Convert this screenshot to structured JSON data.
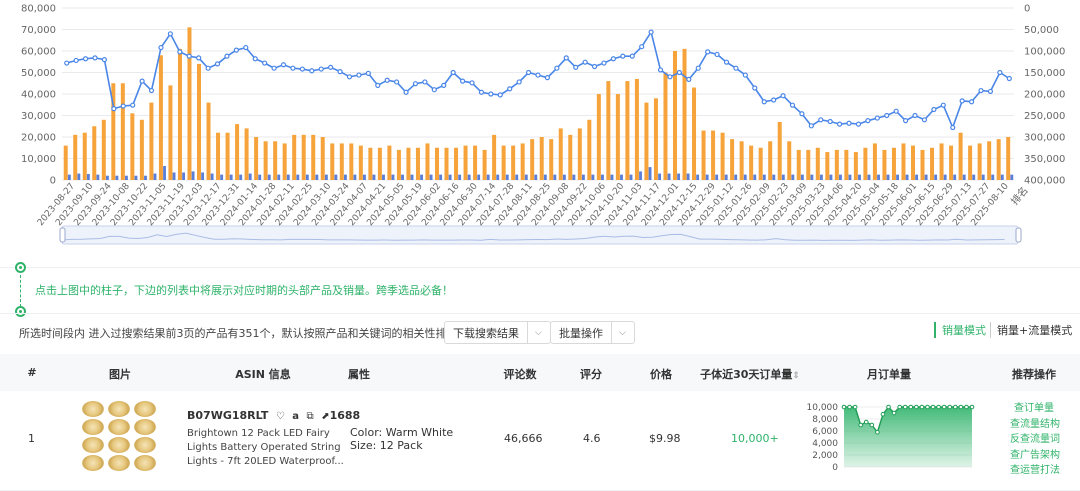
{
  "chart_data": {
    "type": "bar+line",
    "y_left_ticks": [
      "0",
      "10,000",
      "20,000",
      "30,000",
      "40,000",
      "50,000",
      "60,000",
      "70,000",
      "80,000"
    ],
    "y_left_range": [
      0,
      80000
    ],
    "y_right_ticks": [
      "0",
      "50,000",
      "100,000",
      "150,000",
      "200,000",
      "250,000",
      "300,000",
      "350,000",
      "400,000"
    ],
    "y_right_range": [
      0,
      400000
    ],
    "y_right_inverted": true,
    "right_axis_label": "排名",
    "x_labels": [
      "2023-08-27",
      "2023-09-10",
      "2023-09-24",
      "2023-10-08",
      "2023-10-22",
      "2023-11-05",
      "2023-11-19",
      "2023-12-03",
      "2023-12-17",
      "2023-12-31",
      "2024-01-14",
      "2024-01-28",
      "2024-02-11",
      "2024-02-25",
      "2024-03-10",
      "2024-03-24",
      "2024-04-07",
      "2024-04-21",
      "2024-05-05",
      "2024-05-19",
      "2024-06-02",
      "2024-06-16",
      "2024-06-30",
      "2024-07-14",
      "2024-07-28",
      "2024-08-11",
      "2024-08-25",
      "2024-09-08",
      "2024-09-22",
      "2024-10-06",
      "2024-10-20",
      "2024-11-03",
      "2024-11-17",
      "2024-12-01",
      "2024-12-15",
      "2024-12-29",
      "2025-01-12",
      "2025-01-26",
      "2025-02-09",
      "2025-02-23",
      "2025-03-09",
      "2025-03-23",
      "2025-04-06",
      "2025-04-20",
      "2025-05-04",
      "2025-05-18",
      "2025-06-01",
      "2025-06-15",
      "2025-06-29",
      "2025-07-13",
      "2025-07-27",
      "2025-08-10"
    ],
    "series": [
      {
        "name": "orange-bars",
        "color": "#f5a33a",
        "values": [
          16000,
          21000,
          22000,
          25000,
          28000,
          45000,
          45000,
          31000,
          28000,
          36000,
          58000,
          44000,
          61000,
          71000,
          54000,
          36000,
          22000,
          22000,
          26000,
          24000,
          20000,
          18000,
          18000,
          17000,
          21000,
          21000,
          21000,
          20000,
          17000,
          17000,
          17000,
          16000,
          15000,
          15000,
          16000,
          14000,
          15000,
          15000,
          17000,
          15000,
          15000,
          15000,
          16000,
          16000,
          14000,
          21000,
          16000,
          16000,
          17000,
          19000,
          20000,
          19000,
          24000,
          21000,
          24000,
          28000,
          40000,
          46000,
          40000,
          46000,
          47000,
          36000,
          38000,
          50000,
          60000,
          61000,
          43000,
          23000,
          23000,
          22000,
          19000,
          18000,
          16000,
          15000,
          18000,
          27000,
          18000,
          14000,
          14000,
          15000,
          13000,
          14000,
          14000,
          13000,
          15000,
          17000,
          14000,
          15000,
          17000,
          16000,
          14000,
          15000,
          17000,
          16000,
          22000,
          16000,
          17000,
          18000,
          19000,
          20000
        ]
      },
      {
        "name": "blue-bars",
        "color": "#5b7fd6",
        "values": [
          2500,
          3000,
          2800,
          2500,
          2000,
          2000,
          2000,
          2000,
          2000,
          3000,
          6500,
          3500,
          3500,
          4000,
          3500,
          3000,
          2500,
          2500,
          2500,
          3000,
          2500,
          2500,
          2500,
          2500,
          2500,
          2500,
          2500,
          2500,
          2500,
          2500,
          2500,
          2500,
          2500,
          2500,
          2500,
          2500,
          2500,
          2500,
          2500,
          2500,
          2500,
          2500,
          2500,
          2500,
          2500,
          2500,
          2500,
          2500,
          2500,
          2500,
          2500,
          2500,
          2500,
          2500,
          2500,
          2500,
          2500,
          2500,
          2500,
          2500,
          4000,
          6000,
          3000,
          3000,
          3000,
          3000,
          2500,
          2500,
          2500,
          2500,
          2500,
          2500,
          2500,
          2500,
          2500,
          2500,
          2500,
          2500,
          2500,
          2500,
          2500,
          2500,
          2500,
          2500,
          2500,
          2500,
          2500,
          2500,
          2500,
          2500,
          2500,
          2500,
          2500,
          2500,
          2500,
          2500,
          2500,
          2500,
          2500,
          2500
        ]
      },
      {
        "name": "rank-line",
        "color": "#4a86e8",
        "axis": "right",
        "values": [
          128000,
          122000,
          118000,
          116000,
          120000,
          234000,
          228000,
          226000,
          170000,
          192000,
          92000,
          60000,
          102000,
          112000,
          116000,
          140000,
          130000,
          112000,
          98000,
          92000,
          118000,
          128000,
          140000,
          132000,
          140000,
          142000,
          146000,
          142000,
          138000,
          148000,
          160000,
          156000,
          152000,
          180000,
          168000,
          172000,
          196000,
          176000,
          172000,
          190000,
          180000,
          150000,
          170000,
          174000,
          196000,
          200000,
          202000,
          188000,
          172000,
          150000,
          156000,
          162000,
          140000,
          116000,
          138000,
          126000,
          136000,
          128000,
          118000,
          112000,
          112000,
          90000,
          56000,
          144000,
          160000,
          150000,
          166000,
          140000,
          102000,
          108000,
          126000,
          140000,
          156000,
          186000,
          218000,
          214000,
          204000,
          226000,
          246000,
          274000,
          260000,
          264000,
          270000,
          268000,
          270000,
          262000,
          256000,
          250000,
          240000,
          262000,
          250000,
          260000,
          236000,
          226000,
          278000,
          216000,
          218000,
          192000,
          194000,
          150000,
          164000
        ]
      }
    ]
  },
  "tip": {
    "text": "点击上图中的柱子，下边的列表中将展示对应时期的头部产品及销量。跨季选品必备！"
  },
  "toolbar": {
    "info": "所选时间段内 进入过搜索结果前3页的产品有351个，默认按照产品和关键词的相关性排序",
    "download_label": "下载搜索结果",
    "batch_label": "批量操作",
    "mode_sales": "销量模式",
    "mode_traffic": "销量+流量模式"
  },
  "table": {
    "headers": {
      "index": "#",
      "image": "图片",
      "asin": "ASIN 信息",
      "attr": "属性",
      "reviews": "评论数",
      "rating": "评分",
      "price": "价格",
      "orders30": "子体近30天订单量",
      "monthly": "月订单量",
      "actions": "推荐操作"
    },
    "rows": [
      {
        "index": "1",
        "asin": "B07WG18RLT",
        "badge": "1688",
        "title_lines": [
          "Brightown 12 Pack LED Fairy",
          "Lights Battery Operated String",
          "Lights - 7ft 20LED Waterproof..."
        ],
        "attr_color": "Color: Warm White",
        "attr_size": "Size: 12 Pack",
        "reviews": "46,666",
        "rating": "4.6",
        "price": "$9.98",
        "orders30": "10,000+",
        "spark_ticks": [
          "10,000",
          "8,000",
          "6,000",
          "4,000",
          "2,000",
          "0"
        ],
        "spark_values": [
          10000,
          10000,
          10000,
          7000,
          7500,
          7000,
          5800,
          8800,
          10000,
          9000,
          10000,
          10000,
          10000,
          10000,
          10000,
          10000,
          10000,
          10000,
          10000,
          10000,
          10000,
          10000,
          10000,
          10000
        ],
        "actions": [
          "查订单量",
          "查流量结构",
          "反查流量词",
          "查广告架构",
          "查运营打法"
        ]
      }
    ]
  }
}
